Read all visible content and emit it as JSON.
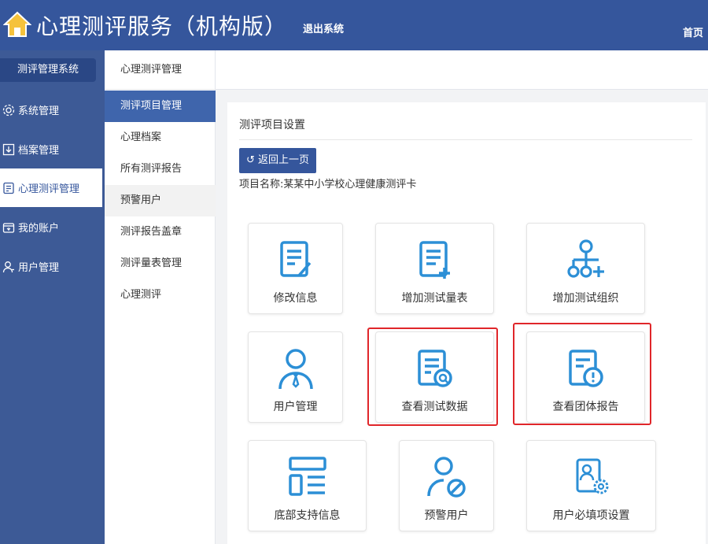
{
  "header": {
    "title": "心理测评服务（机构版）",
    "logout_label": "退出系统",
    "home_label": "首页"
  },
  "sidebar": {
    "system_label": "测评管理系统",
    "items": [
      {
        "label": "系统管理",
        "icon": "gear-icon"
      },
      {
        "label": "档案管理",
        "icon": "archive-icon"
      },
      {
        "label": "心理测评管理",
        "icon": "document-icon"
      },
      {
        "label": "我的账户",
        "icon": "wallet-icon"
      },
      {
        "label": "用户管理",
        "icon": "user-icon"
      }
    ]
  },
  "subnav": {
    "header": "心理测评管理",
    "items": [
      {
        "label": "测评项目管理"
      },
      {
        "label": "心理档案"
      },
      {
        "label": "所有测评报告"
      },
      {
        "label": "预警用户"
      },
      {
        "label": "测评报告盖章"
      },
      {
        "label": "测评量表管理"
      },
      {
        "label": "心理测评"
      }
    ]
  },
  "panel": {
    "title": "测评项目设置",
    "back_label": "返回上一页",
    "project_name": "项目名称:某某中小学校心理健康测评卡"
  },
  "cards": [
    {
      "label": "修改信息",
      "icon": "edit-document-icon"
    },
    {
      "label": "增加测试量表",
      "icon": "add-document-icon"
    },
    {
      "label": "增加测试组织",
      "icon": "add-organization-icon"
    },
    {
      "label": "用户管理",
      "icon": "user-manager-icon"
    },
    {
      "label": "查看测试数据",
      "icon": "search-document-icon"
    },
    {
      "label": "查看团体报告",
      "icon": "alert-report-icon"
    },
    {
      "label": "底部支持信息",
      "icon": "layout-icon"
    },
    {
      "label": "预警用户",
      "icon": "blocked-user-icon"
    },
    {
      "label": "用户必填项设置",
      "icon": "user-settings-icon"
    }
  ],
  "colors": {
    "header_bg": "#35569c",
    "sidebar_bg": "#3d5a96",
    "icon_blue": "#2c8fd6",
    "highlight_red": "#e0262a"
  }
}
